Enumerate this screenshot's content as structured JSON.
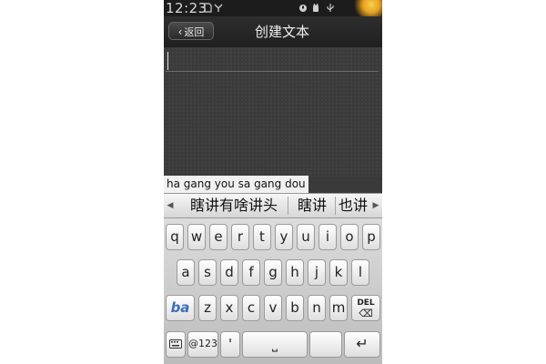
{
  "status_bar": {
    "time": "12:23",
    "icons": [
      "sim-card-icon",
      "signal-icon",
      "alarm-icon",
      "android-debug-icon",
      "usb-icon"
    ]
  },
  "header": {
    "back_label": "返回",
    "back_icon": "chevron-left-icon",
    "title": "创建文本"
  },
  "editor": {
    "value": ""
  },
  "ime": {
    "composition": "ha gang you sa gang dou",
    "candidates": [
      "瞎讲有啥讲头",
      "瞎讲",
      "也讲"
    ],
    "left_arrow_icon": "triangle-left-icon",
    "right_arrow_icon": "triangle-right-icon"
  },
  "keyboard": {
    "row1": [
      "q",
      "w",
      "e",
      "r",
      "t",
      "y",
      "u",
      "i",
      "o",
      "p"
    ],
    "row2": [
      "a",
      "s",
      "d",
      "f",
      "g",
      "h",
      "j",
      "k",
      "l"
    ],
    "row3": [
      "z",
      "x",
      "c",
      "v",
      "b",
      "n",
      "m"
    ],
    "logo_label": "ba",
    "del_label": "DEL",
    "num_label": "@123",
    "apostrophe": "'",
    "space_glyph": "⎵",
    "enter_glyph": "↵",
    "keyboard_icon": "keyboard-icon"
  },
  "colors": {
    "screen_bg": "#3a3a3a",
    "status_bg": "#1c1c1c",
    "keyboard_bg": "#c8c8c8",
    "accent": "#e8a020"
  }
}
